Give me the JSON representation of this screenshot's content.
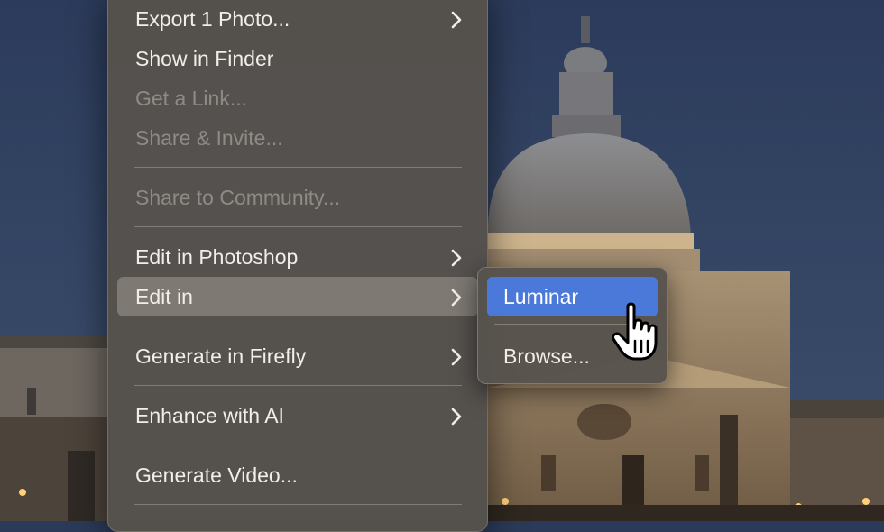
{
  "menu": {
    "items": [
      {
        "label": "Export 1 Photo...",
        "submenu": true,
        "disabled": false
      },
      {
        "label": "Show in Finder",
        "submenu": false,
        "disabled": false
      },
      {
        "label": "Get a Link...",
        "submenu": false,
        "disabled": true
      },
      {
        "label": "Share & Invite...",
        "submenu": false,
        "disabled": true
      },
      {
        "label": "Share to Community...",
        "submenu": false,
        "disabled": true
      },
      {
        "label": "Edit in Photoshop",
        "submenu": true,
        "disabled": false
      },
      {
        "label": "Edit in",
        "submenu": true,
        "disabled": false,
        "highlighted": true
      },
      {
        "label": "Generate in Firefly",
        "submenu": true,
        "disabled": false
      },
      {
        "label": "Enhance with AI",
        "submenu": true,
        "disabled": false
      },
      {
        "label": "Generate Video...",
        "submenu": false,
        "disabled": false
      }
    ]
  },
  "submenu": {
    "items": [
      {
        "label": "Luminar",
        "selected": true
      },
      {
        "label": "Browse...",
        "selected": false
      }
    ]
  },
  "colors": {
    "menu_bg": "#56524d",
    "selected_bg": "#4a79d9",
    "text": "#f1eeea",
    "disabled_text": "#8f8a84",
    "sky": "#2e3d5c"
  },
  "icons": {
    "submenu_indicator": "chevron-right-icon",
    "cursor": "pointing-hand-cursor-icon"
  }
}
